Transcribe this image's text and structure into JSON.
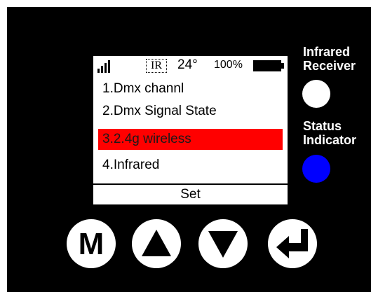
{
  "status_bar": {
    "ir_label": "IR",
    "temperature": "24°",
    "battery_percent": "100%",
    "battery_level": 1.0,
    "signal_bars": 4
  },
  "menu": {
    "items": [
      {
        "label": "1.Dmx channl"
      },
      {
        "label": "2.Dmx Signal State"
      },
      {
        "label": "3.2.4g wireless"
      },
      {
        "label": "4.Infrared"
      }
    ],
    "selected_index": 2,
    "footer_label": "Set"
  },
  "indicators": {
    "infrared_receiver": {
      "line1": "Infrared",
      "line2": "Receiver",
      "color": "#ffffff"
    },
    "status_indicator": {
      "line1": "Status",
      "line2": "Indicator",
      "color": "#0000ff"
    }
  },
  "buttons": {
    "menu_label": "M",
    "up_icon": "triangle-up-icon",
    "down_icon": "triangle-down-icon",
    "enter_icon": "enter-arrow-icon"
  },
  "colors": {
    "panel": "#000000",
    "selection": "#ff0000",
    "screen": "#ffffff"
  }
}
